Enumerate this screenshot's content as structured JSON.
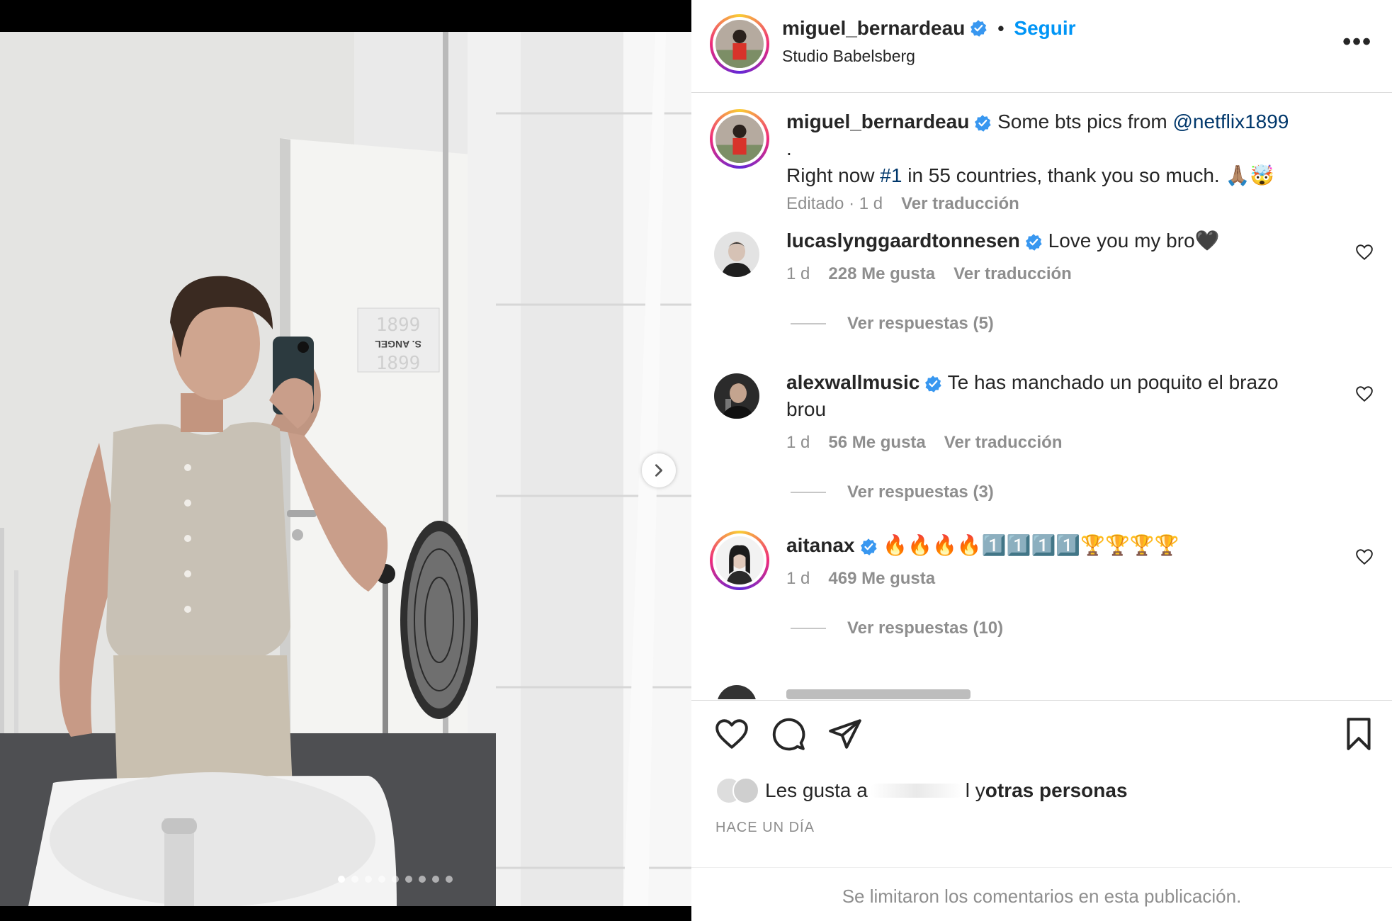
{
  "post": {
    "username": "miguel_bernardeau",
    "location": "Studio Babelsberg",
    "follow_label": "Seguir",
    "separator": "•",
    "more_label": "•••"
  },
  "photo": {
    "slide_count": 9,
    "active_slide": 1,
    "sign_top": "1899",
    "sign_middle": "S. ANGEL",
    "sign_bottom": "1899"
  },
  "caption": {
    "username": "miguel_bernardeau",
    "text_1": " Some bts pics from ",
    "mention": "@netflix1899",
    "text_2": " .",
    "text_3": "Right now ",
    "hashtag": "#1",
    "text_4": " in 55 countries, thank you so much. 🙏🏽🤯",
    "edited": "Editado · 1 d",
    "translate": "Ver traducción"
  },
  "comments": [
    {
      "username": "lucaslynggaardtonnesen",
      "text": "Love you my bro🖤",
      "time": "1 d",
      "likes": "228 Me gusta",
      "translate": "Ver traducción",
      "replies": "Ver respuestas (5)"
    },
    {
      "username": "alexwallmusic",
      "text": "Te has manchado un poquito el brazo",
      "text_2": "brou",
      "time": "1 d",
      "likes": "56 Me gusta",
      "translate": "Ver traducción",
      "replies": "Ver respuestas (3)"
    },
    {
      "username": "aitanax",
      "text": "🔥🔥🔥🔥1️⃣1️⃣1️⃣1️⃣🏆🏆🏆🏆",
      "time": "1 d",
      "likes": "469 Me gusta",
      "replies": "Ver respuestas (10)"
    }
  ],
  "likes": {
    "prefix": "Les gusta a",
    "suffix_1": "l y ",
    "suffix_2": "otras personas"
  },
  "date": "HACE UN DÍA",
  "limited_comments": "Se limitaron los comentarios en esta publicación.",
  "colors": {
    "link_blue": "#0095f6",
    "verified_blue": "#3897f0",
    "muted": "#8e8e8e",
    "text": "#262626"
  }
}
